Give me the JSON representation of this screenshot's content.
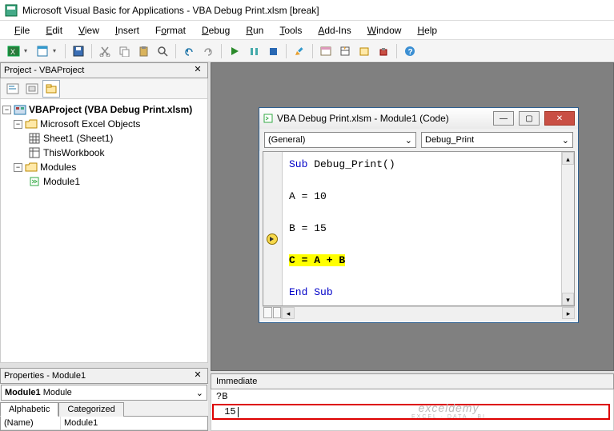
{
  "title": "Microsoft Visual Basic for Applications - VBA Debug Print.xlsm [break]",
  "menus": [
    "File",
    "Edit",
    "View",
    "Insert",
    "Format",
    "Debug",
    "Run",
    "Tools",
    "Add-Ins",
    "Window",
    "Help"
  ],
  "project_panel": {
    "title": "Project - VBAProject",
    "root": "VBAProject (VBA Debug Print.xlsm)",
    "folder1": "Microsoft Excel Objects",
    "sheet1": "Sheet1 (Sheet1)",
    "thiswb": "ThisWorkbook",
    "folder2": "Modules",
    "module1": "Module1"
  },
  "props_panel": {
    "title": "Properties - Module1",
    "combo_name": "Module1",
    "combo_type": "Module",
    "tab_alpha": "Alphabetic",
    "tab_cat": "Categorized",
    "prop_name_k": "(Name)",
    "prop_name_v": "Module1"
  },
  "code_window": {
    "title": "VBA Debug Print.xlsm - Module1 (Code)",
    "dd_left": "(General)",
    "dd_right": "Debug_Print",
    "line1_a": "Sub",
    "line1_b": " Debug_Print()",
    "line3": "A = 10",
    "line5": "B = 15",
    "line7": "C = A + B",
    "line9_a": "End",
    "line9_b": "Sub"
  },
  "immediate": {
    "title": "Immediate",
    "input": "?B",
    "output": "15"
  },
  "watermark": {
    "main": "exceldemy",
    "sub": "EXCEL · DATA · BI"
  }
}
